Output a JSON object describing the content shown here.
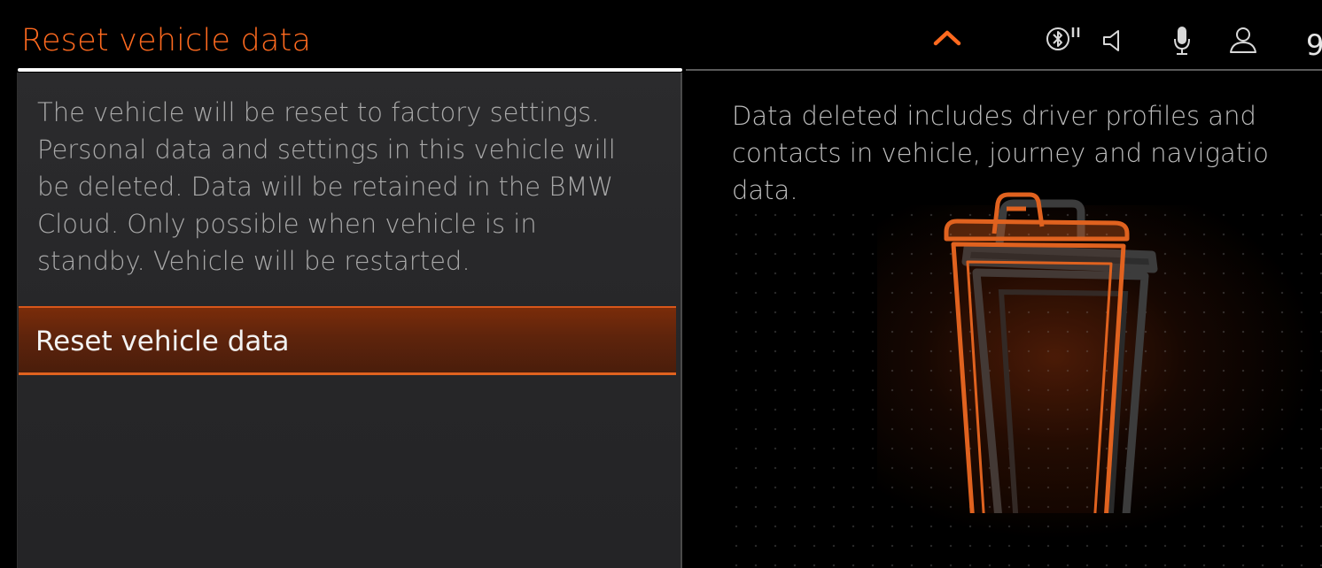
{
  "header": {
    "title": "Reset vehicle data",
    "clock_partial": "9"
  },
  "icons": {
    "chevron": "chevron-up-icon",
    "bluetooth": "bluetooth-icon",
    "speaker": "speaker-muted-icon",
    "microphone": "microphone-icon",
    "user": "user-profile-icon",
    "illustration": "trash-can-icon"
  },
  "colors": {
    "accent": "#ff6a1f",
    "button_border": "#e0621f"
  },
  "left_panel": {
    "description_lines": [
      "The vehicle will be reset to factory settings.",
      "Personal data and settings in this vehicle will",
      "be deleted. Data will be retained in the BMW",
      "Cloud. Only possible when vehicle is in",
      "standby. Vehicle will be restarted."
    ],
    "reset_button_label": "Reset vehicle data"
  },
  "right_panel": {
    "info_lines": [
      "Data deleted includes driver profiles and",
      "contacts in vehicle, journey and navigatio",
      "data."
    ]
  }
}
